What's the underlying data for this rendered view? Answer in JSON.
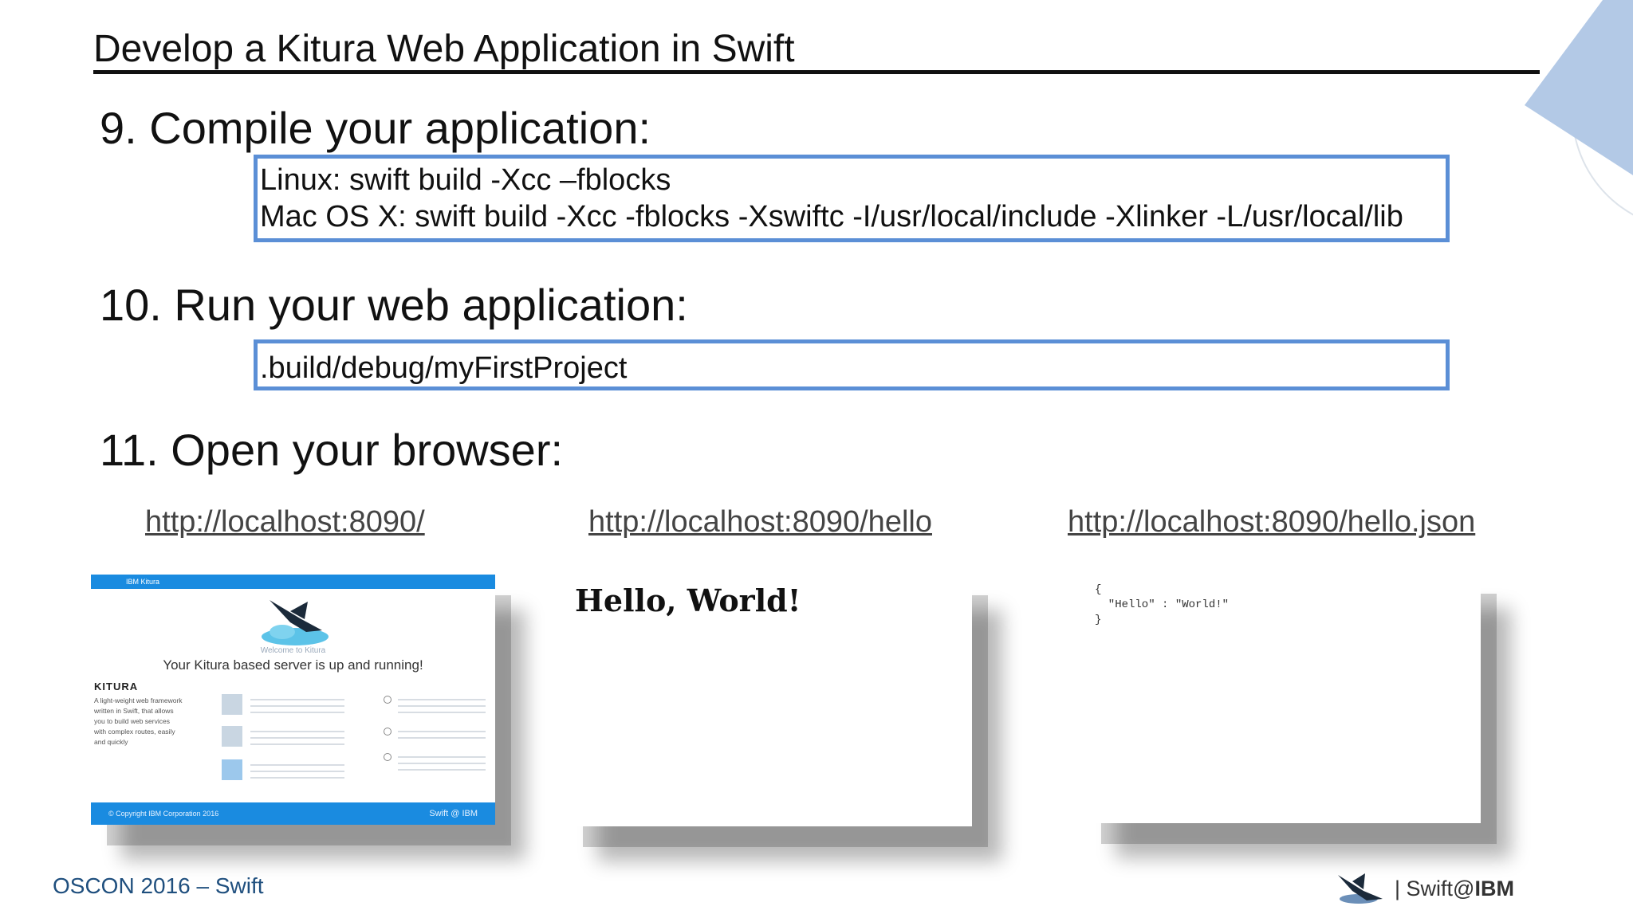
{
  "slide": {
    "title": "Develop a Kitura Web Application in Swift"
  },
  "steps": [
    {
      "label": "9. Compile your application:"
    },
    {
      "label": "10. Run your web application:"
    },
    {
      "label": "11. Open your browser:"
    }
  ],
  "compile_box": {
    "line1": "Linux: swift build -Xcc –fblocks",
    "line2": "Mac OS X: swift build -Xcc -fblocks -Xswiftc -I/usr/local/include -Xlinker -L/usr/local/lib"
  },
  "run_box": {
    "command": ".build/debug/myFirstProject"
  },
  "urls": [
    "http://localhost:8090/",
    "http://localhost:8090/hello",
    "http://localhost:8090/hello.json"
  ],
  "kitura_shot": {
    "topbar": "IBM Kitura",
    "welcome": "Welcome to Kitura",
    "headline": "Your Kitura based server is up and running!",
    "brand": "KITURA",
    "description": "A light-weight web framework written in Swift, that allows you to build web services with complex routes, easily and quickly",
    "footer": "© Copyright IBM Corporation 2016",
    "footer_brand": "Swift @ IBM"
  },
  "hello_shot": {
    "text": "Hello, World!"
  },
  "json_shot": {
    "text": "{\n  \"Hello\" : \"World!\"\n}"
  },
  "footer": {
    "event": "OSCON 2016 – Swift",
    "brand_prefix": "| Swift@",
    "brand_suffix": "IBM"
  },
  "colors": {
    "box_border": "#5b8fd6",
    "kitura_blue": "#1a8be0",
    "footer_text": "#1f4f7e",
    "corner_shape": "#b3c9e6"
  }
}
